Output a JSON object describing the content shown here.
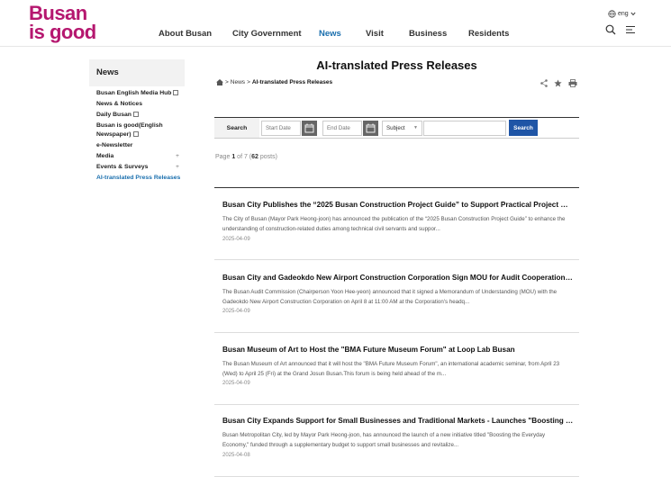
{
  "header": {
    "logo_line1": "Busan",
    "logo_line2": "is good",
    "nav": [
      "About Busan",
      "City Government",
      "News",
      "Visit",
      "Business",
      "Residents"
    ],
    "active_nav": "News",
    "lang": "eng",
    "brand_color": "#b5176f",
    "accent_color": "#1a6fae"
  },
  "sidebar": {
    "title": "News",
    "items": [
      {
        "label": "Busan English Media Hub",
        "external": true
      },
      {
        "label": "News & Notices"
      },
      {
        "label": "Daily Busan",
        "external": true
      },
      {
        "label": "Busan is good(English Newspaper)",
        "external": true
      },
      {
        "label": "e-Newsletter"
      },
      {
        "label": "Media",
        "expandable": true
      },
      {
        "label": "Events & Surveys",
        "expandable": true
      },
      {
        "label": "AI-translated Press Releases",
        "active": true
      }
    ]
  },
  "main": {
    "title": "AI-translated Press Releases",
    "breadcrumb": {
      "sep1": ">",
      "news": "News",
      "sep2": ">",
      "current": "AI-translated Press Releases"
    },
    "search": {
      "label": "Search",
      "start_placeholder": "Start Date",
      "end_placeholder": "End Date",
      "select_value": "Subject",
      "button": "Search"
    },
    "paging": {
      "prefix": "Page",
      "page": "1",
      "of": "of 7 (",
      "count": "62",
      "suffix": "posts)"
    },
    "posts": [
      {
        "title": "Busan City Publishes the “2025 Busan Construction Project Guide” to Support Practical Project Ma...",
        "desc": "The City of Busan (Mayor Park Heong-joon) has announced the publication of the “2025 Busan Construction Project Guide” to enhance the understanding of construction-related duties among technical civil servants and suppor...",
        "date": "2025-04-09"
      },
      {
        "title": "Busan City and Gadeokdo New Airport Construction Corporation Sign MOU for Audit Cooperation to...",
        "desc": "The Busan Audit Commission (Chairperson Yoon Hee-yeon) announced that it signed a Memorandum of Understanding (MOU) with the Gadeokdo New Airport Construction Corporation on April 8 at 11:00 AM at the Corporation's headq...",
        "date": "2025-04-09"
      },
      {
        "title": "Busan Museum of Art to Host the \"BMA Future Museum Forum\" at Loop Lab Busan",
        "desc": "The Busan Museum of Art announced that it will host the \"BMA Future Museum Forum\", an international academic seminar, from April 23 (Wed) to April 25 (Fri) at the Grand Josun Busan.This forum is being held ahead of the m...",
        "date": "2025-04-09"
      },
      {
        "title": "Busan City Expands Support for Small Businesses and Traditional Markets - Launches \"Boosting th...",
        "desc": "Busan Metropolitan City, led by Mayor Park Heong-joon, has announced the launch of a new initiative titled \"Boosting the Everyday Economy,\" funded through a supplementary budget to support small businesses and revitalize...",
        "date": "2025-04-08"
      }
    ]
  }
}
